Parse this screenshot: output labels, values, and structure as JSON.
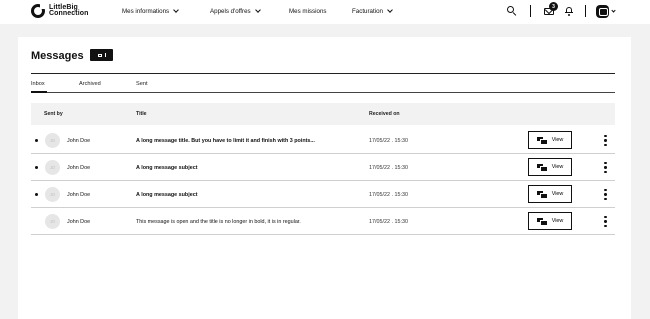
{
  "brand": {
    "line1": "LittleBig",
    "line2": "Connection"
  },
  "nav": {
    "items": [
      {
        "label": "Mes informations",
        "has_dropdown": true
      },
      {
        "label": "Appels d'offres",
        "has_dropdown": true
      },
      {
        "label": "Mes missions",
        "has_dropdown": false
      },
      {
        "label": "Facturation",
        "has_dropdown": true
      }
    ],
    "notifications_count": "3"
  },
  "page": {
    "title": "Messages"
  },
  "tabs": [
    {
      "label": "Inbox",
      "active": true
    },
    {
      "label": "Archived",
      "active": false
    },
    {
      "label": "Sent",
      "active": false
    }
  ],
  "table": {
    "headers": {
      "sent_by": "Sent by",
      "title": "Title",
      "received_on": "Received on"
    },
    "rows": [
      {
        "initials": "JD",
        "sender": "John Doe",
        "title": "A long message title. But you have to limit it and finish with 3 points...",
        "received": "17/05/22 . 15:30",
        "unread": true,
        "view_label": "View"
      },
      {
        "initials": "JD",
        "sender": "John Doe",
        "title": "A long message subject",
        "received": "17/05/22 . 15:30",
        "unread": true,
        "view_label": "View"
      },
      {
        "initials": "JD",
        "sender": "John Doe",
        "title": "A long message subject",
        "received": "17/05/22 . 15:30",
        "unread": true,
        "view_label": "View"
      },
      {
        "initials": "JD",
        "sender": "John Doe",
        "title": "This message is open and the title is no longer in bold, it is in regular.",
        "received": "17/05/22 . 15:30",
        "unread": false,
        "view_label": "View"
      }
    ]
  },
  "colors": {
    "primary": "#111111",
    "background": "#f2f2f2",
    "surface": "#ffffff"
  }
}
